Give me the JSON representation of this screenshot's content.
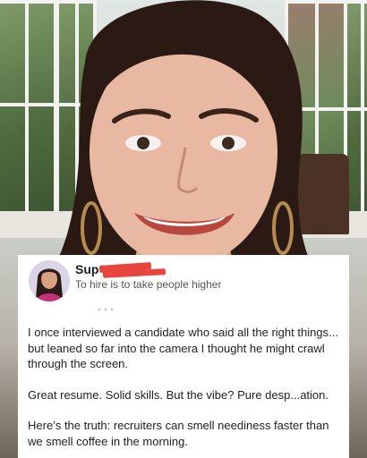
{
  "post": {
    "author_name": "Sup",
    "author_tagline": "To hire is to take people higher",
    "paragraphs": [
      "I once interviewed a candidate who said all the right things... but leaned so far into the camera I thought he might crawl through the screen.",
      "Great resume. Solid skills. But the vibe? Pure desp...ation.",
      "Here’s the truth: recruiters can smell neediness faster than we smell coffee in the morning."
    ]
  },
  "colors": {
    "card_background": "#ffffff",
    "redaction": "#e7463f",
    "tagline": "#555555"
  }
}
